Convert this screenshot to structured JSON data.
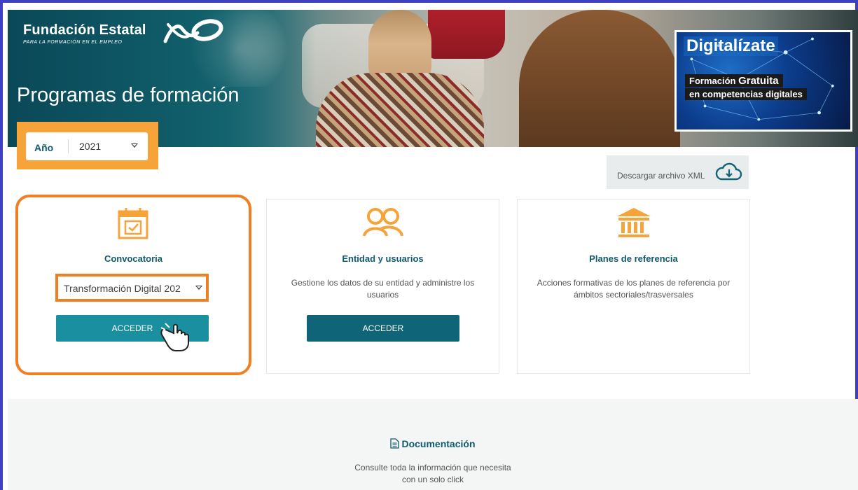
{
  "header": {
    "brand_name": "Fundación Estatal",
    "brand_sub": "PARA LA FORMACIÓN EN EL EMPLEO",
    "page_title": "Programas de formación"
  },
  "banner": {
    "title": "Digitalízate",
    "line1_prefix": "Formación ",
    "line1_emph": "Gratuita",
    "line2": "en competencias digitales"
  },
  "year_filter": {
    "label": "Año",
    "value": "2021"
  },
  "xml_download": {
    "label": "Descargar archivo XML",
    "icon": "cloud-download-icon"
  },
  "cards": [
    {
      "title": "Convocatoria",
      "icon": "calendar-check-icon",
      "select_value": "Transformación Digital 202",
      "button": "ACCEDER"
    },
    {
      "title": "Entidad y usuarios",
      "icon": "users-icon",
      "description": "Gestione los datos de su entidad y administre los usuarios",
      "button": "ACCEDER"
    },
    {
      "title": "Planes de referencia",
      "icon": "institution-icon",
      "description": "Acciones formativas de los planes de referencia por ámbitos sectoriales/trasversales"
    }
  ],
  "documentation": {
    "title": "Documentación",
    "description_line1": "Consulte toda la información que necesita",
    "description_line2": "con un solo click"
  },
  "colors": {
    "primary": "#0f5b6d",
    "button_teal": "#1a8fa0",
    "button_dark": "#0f6577",
    "highlight_orange": "#f07e22",
    "icon_orange": "#f6a33a",
    "frame": "#3f3fc4"
  }
}
